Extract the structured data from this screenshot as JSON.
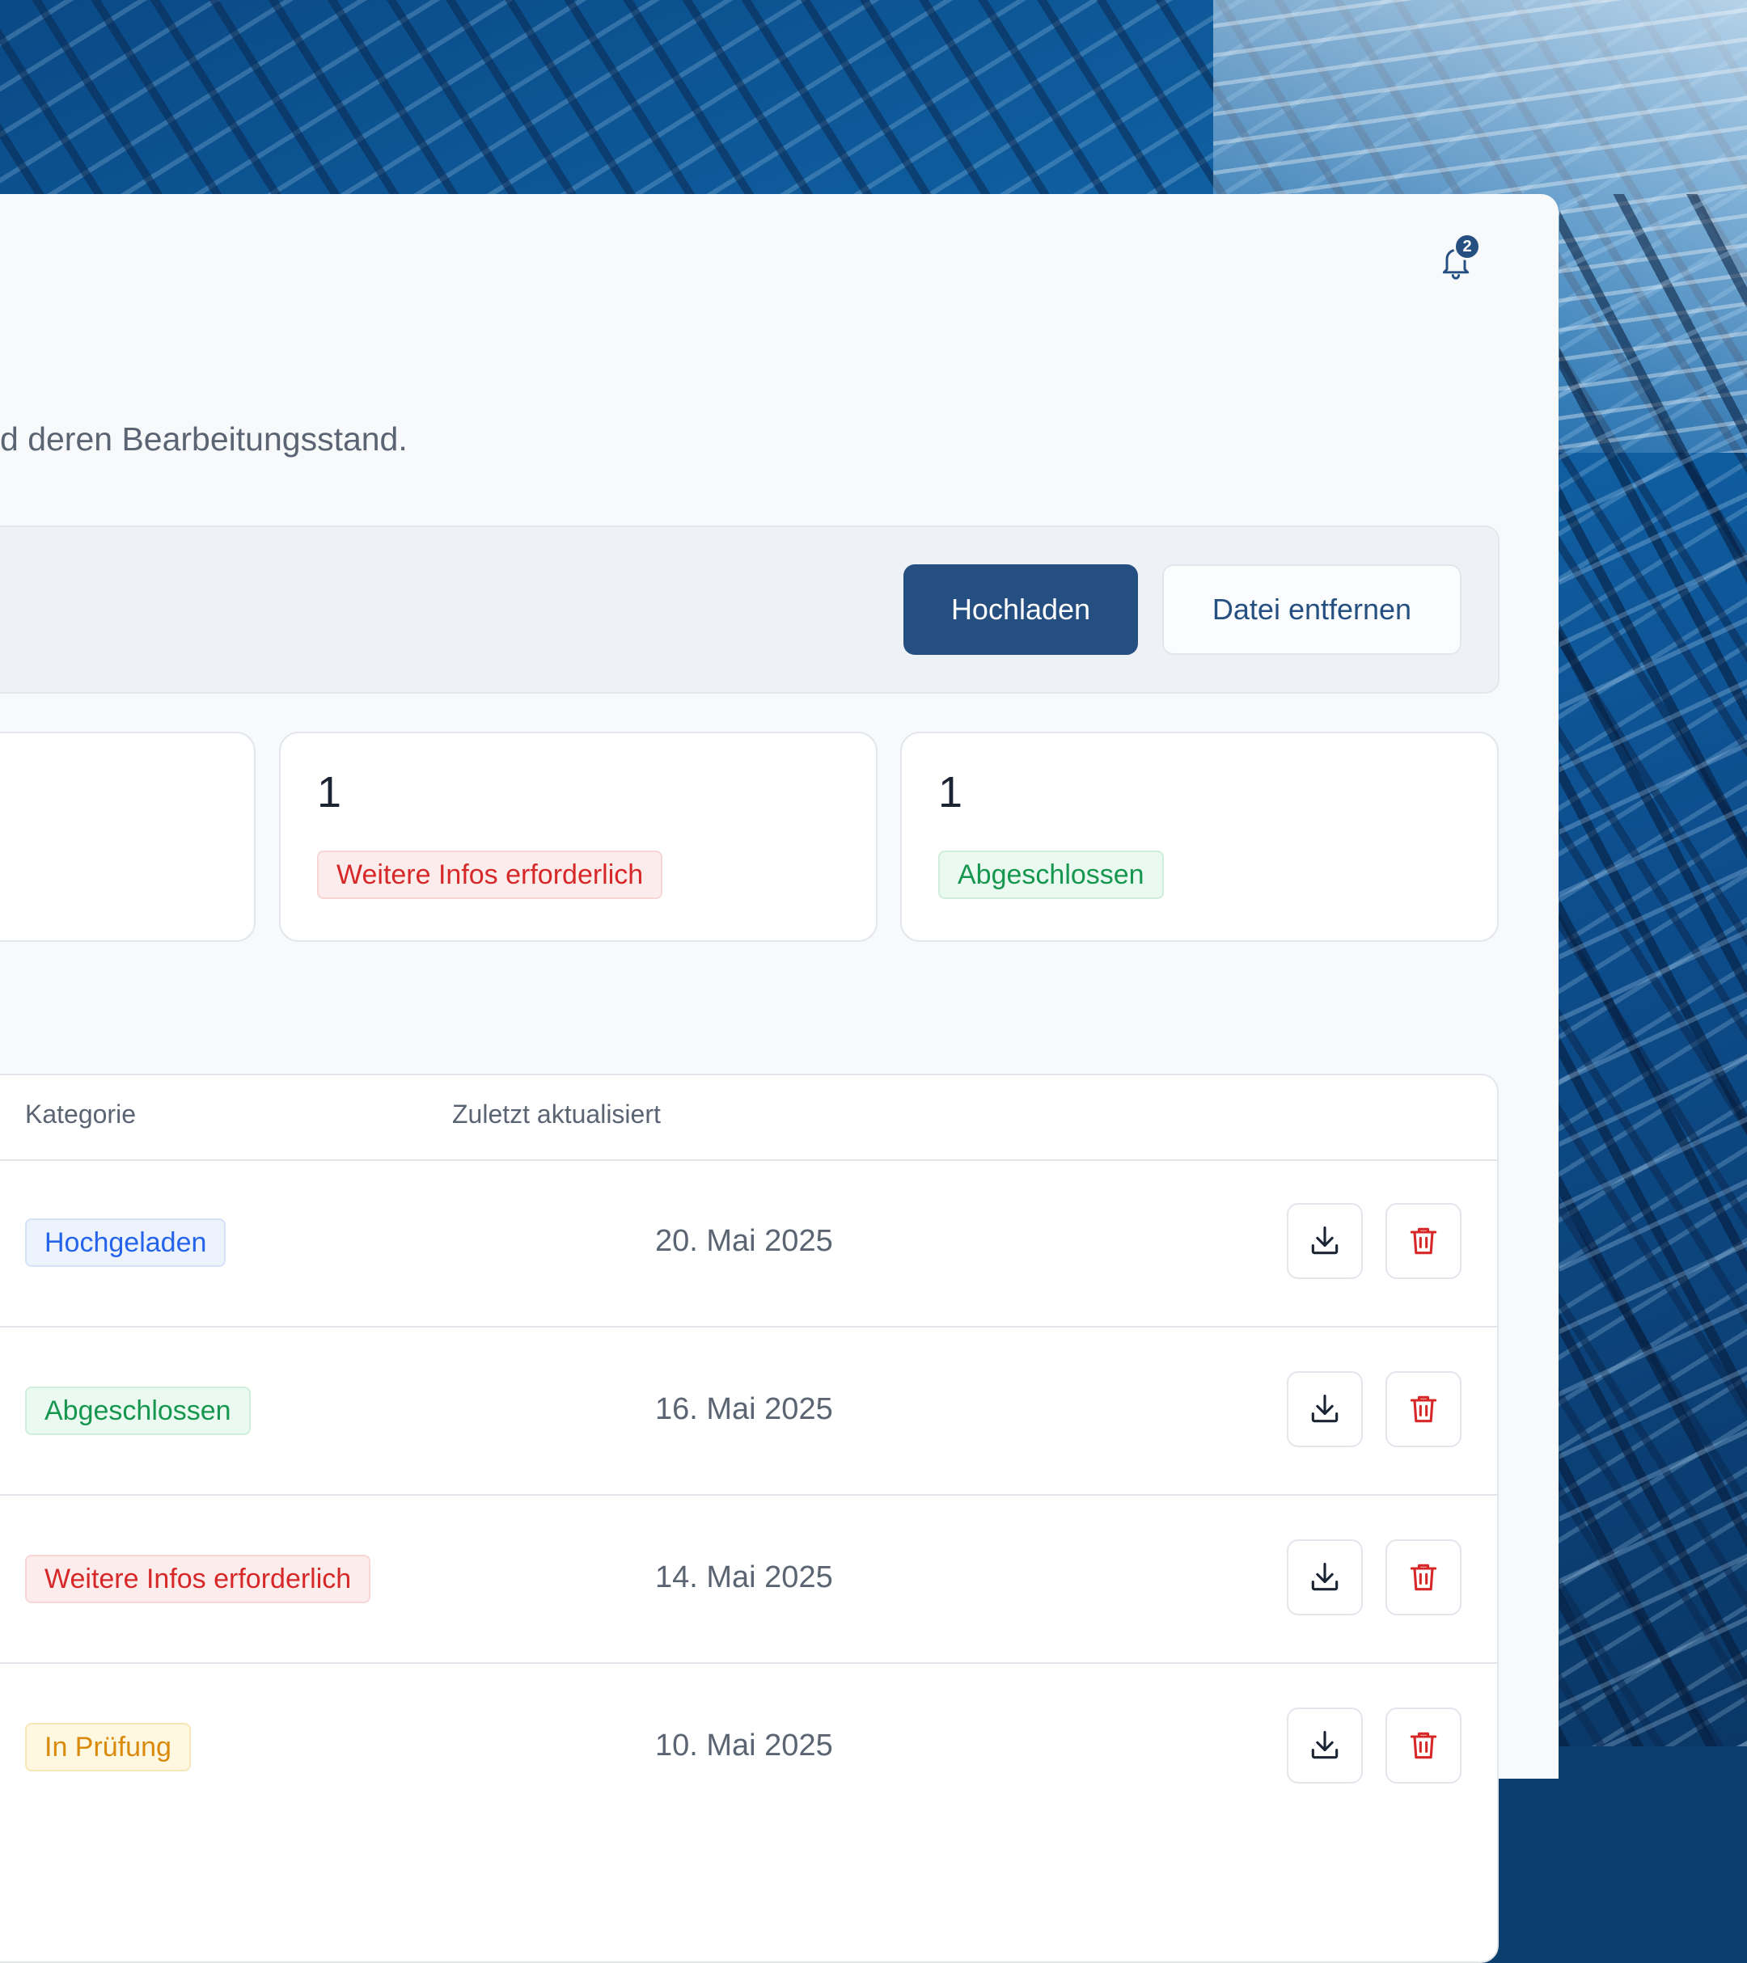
{
  "header": {
    "subtitle": "d deren Bearbeitungsstand.",
    "notifications": {
      "icon": "bell-icon",
      "count": "2"
    }
  },
  "toolbar": {
    "upload_label": "Hochladen",
    "remove_label": "Datei entfernen"
  },
  "summary_cards": [
    {
      "count": "",
      "status": ""
    },
    {
      "count": "1",
      "status": "Weitere Infos erforderlich"
    },
    {
      "count": "1",
      "status": "Abgeschlossen"
    }
  ],
  "table": {
    "columns": [
      "Kategorie",
      "Zuletzt aktualisiert"
    ],
    "rows": [
      {
        "status": "Hochgeladen",
        "date": "20. Mai 2025"
      },
      {
        "status": "Abgeschlossen",
        "date": "16. Mai 2025"
      },
      {
        "status": "Weitere Infos erforderlich",
        "date": "14. Mai 2025"
      },
      {
        "status": "In Prüfung",
        "date": "10. Mai 2025"
      }
    ],
    "row_action_icons": [
      "download-icon",
      "trash-icon"
    ]
  },
  "colors": {
    "primary": "#254f80",
    "status_red": "#d62828",
    "status_green": "#179650",
    "status_blue": "#2563eb",
    "status_yellow": "#d98a0b"
  }
}
